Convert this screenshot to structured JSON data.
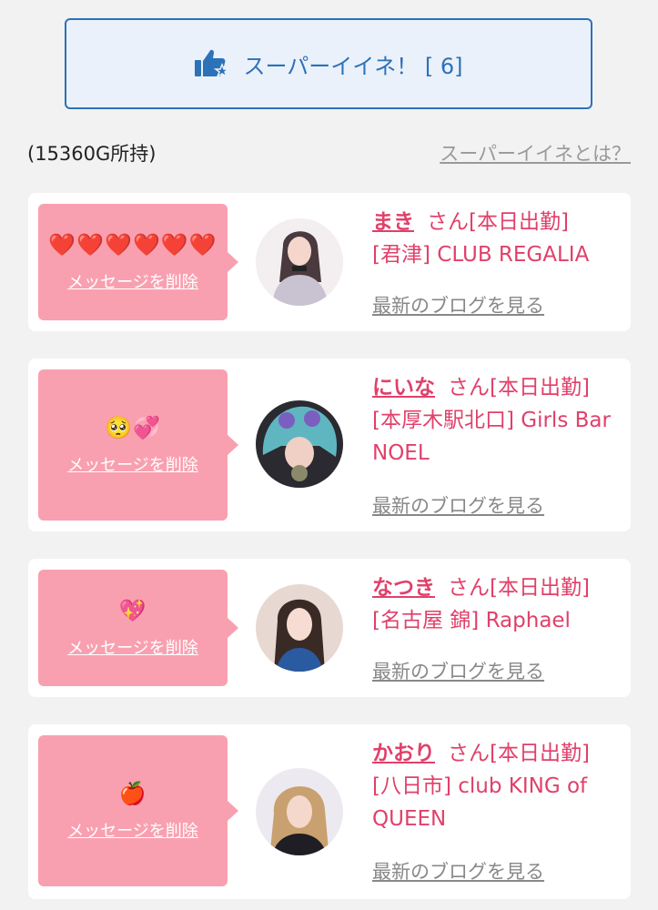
{
  "super_iine": {
    "label": "スーパーイイネ！ [ 6]",
    "icon": "thumbs-up-star-icon",
    "border_color": "#2c72b8",
    "background_color": "#ebf1fa"
  },
  "balance_text": "(15360G所持)",
  "what_is_link": "スーパーイイネとは？",
  "cards": [
    {
      "message": "❤️❤️❤️❤️❤️❤️",
      "delete_label": "メッセージを削除",
      "name": "まき",
      "suffix": "さん[本日出勤]",
      "shop": "[君津] CLUB REGALIA",
      "blog_label": "最新のブログを見る"
    },
    {
      "message": "🥺💞",
      "delete_label": "メッセージを削除",
      "name": "にいな",
      "suffix": "さん[本日出勤]",
      "shop": "[本厚木駅北口] Girls Bar NOEL",
      "blog_label": "最新のブログを見る"
    },
    {
      "message": "💖",
      "delete_label": "メッセージを削除",
      "name": "なつき",
      "suffix": "さん[本日出勤]",
      "shop": "[名古屋 錦] Raphael",
      "blog_label": "最新のブログを見る"
    },
    {
      "message": "🍎",
      "delete_label": "メッセージを削除",
      "name": "かおり",
      "suffix": "さん[本日出勤]",
      "shop": "[八日市] club KING of QUEEN",
      "blog_label": "最新のブログを見る"
    }
  ],
  "colors": {
    "accent_pink": "#e0406a",
    "bubble_pink": "#f9a0b0",
    "page_background": "#f2f2f2"
  }
}
